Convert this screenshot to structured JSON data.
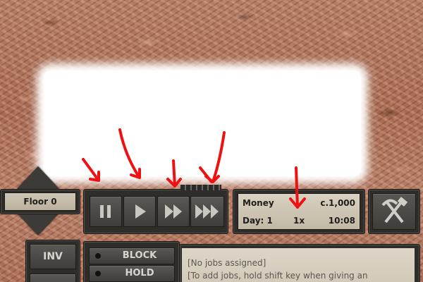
{
  "floor": {
    "label": "Floor 0"
  },
  "speed_controls": {
    "buttons": [
      {
        "name": "pause",
        "icon": "pause-icon"
      },
      {
        "name": "play",
        "icon": "play-icon"
      },
      {
        "name": "fast",
        "icon": "fast-forward-icon"
      },
      {
        "name": "fastest",
        "icon": "fastest-forward-icon"
      }
    ]
  },
  "status": {
    "money_label": "Money",
    "money_value": "c.1,000",
    "day_label": "Day: 1",
    "speed": "1x",
    "time": "10:08"
  },
  "build_button": {
    "icon": "hammer-pickaxe-icon"
  },
  "sidebar": {
    "inv_label": "INV"
  },
  "job_buttons": {
    "block_label": "BLOCK",
    "hold_label": "HOLD"
  },
  "jobs_panel": {
    "line1": "[No jobs assigned]",
    "line2": "[To add jobs, hold shift key when giving an"
  },
  "colors": {
    "panel": "#2e2d2a",
    "paper": "#d8d0c0",
    "annotation_red": "#ee1111"
  }
}
